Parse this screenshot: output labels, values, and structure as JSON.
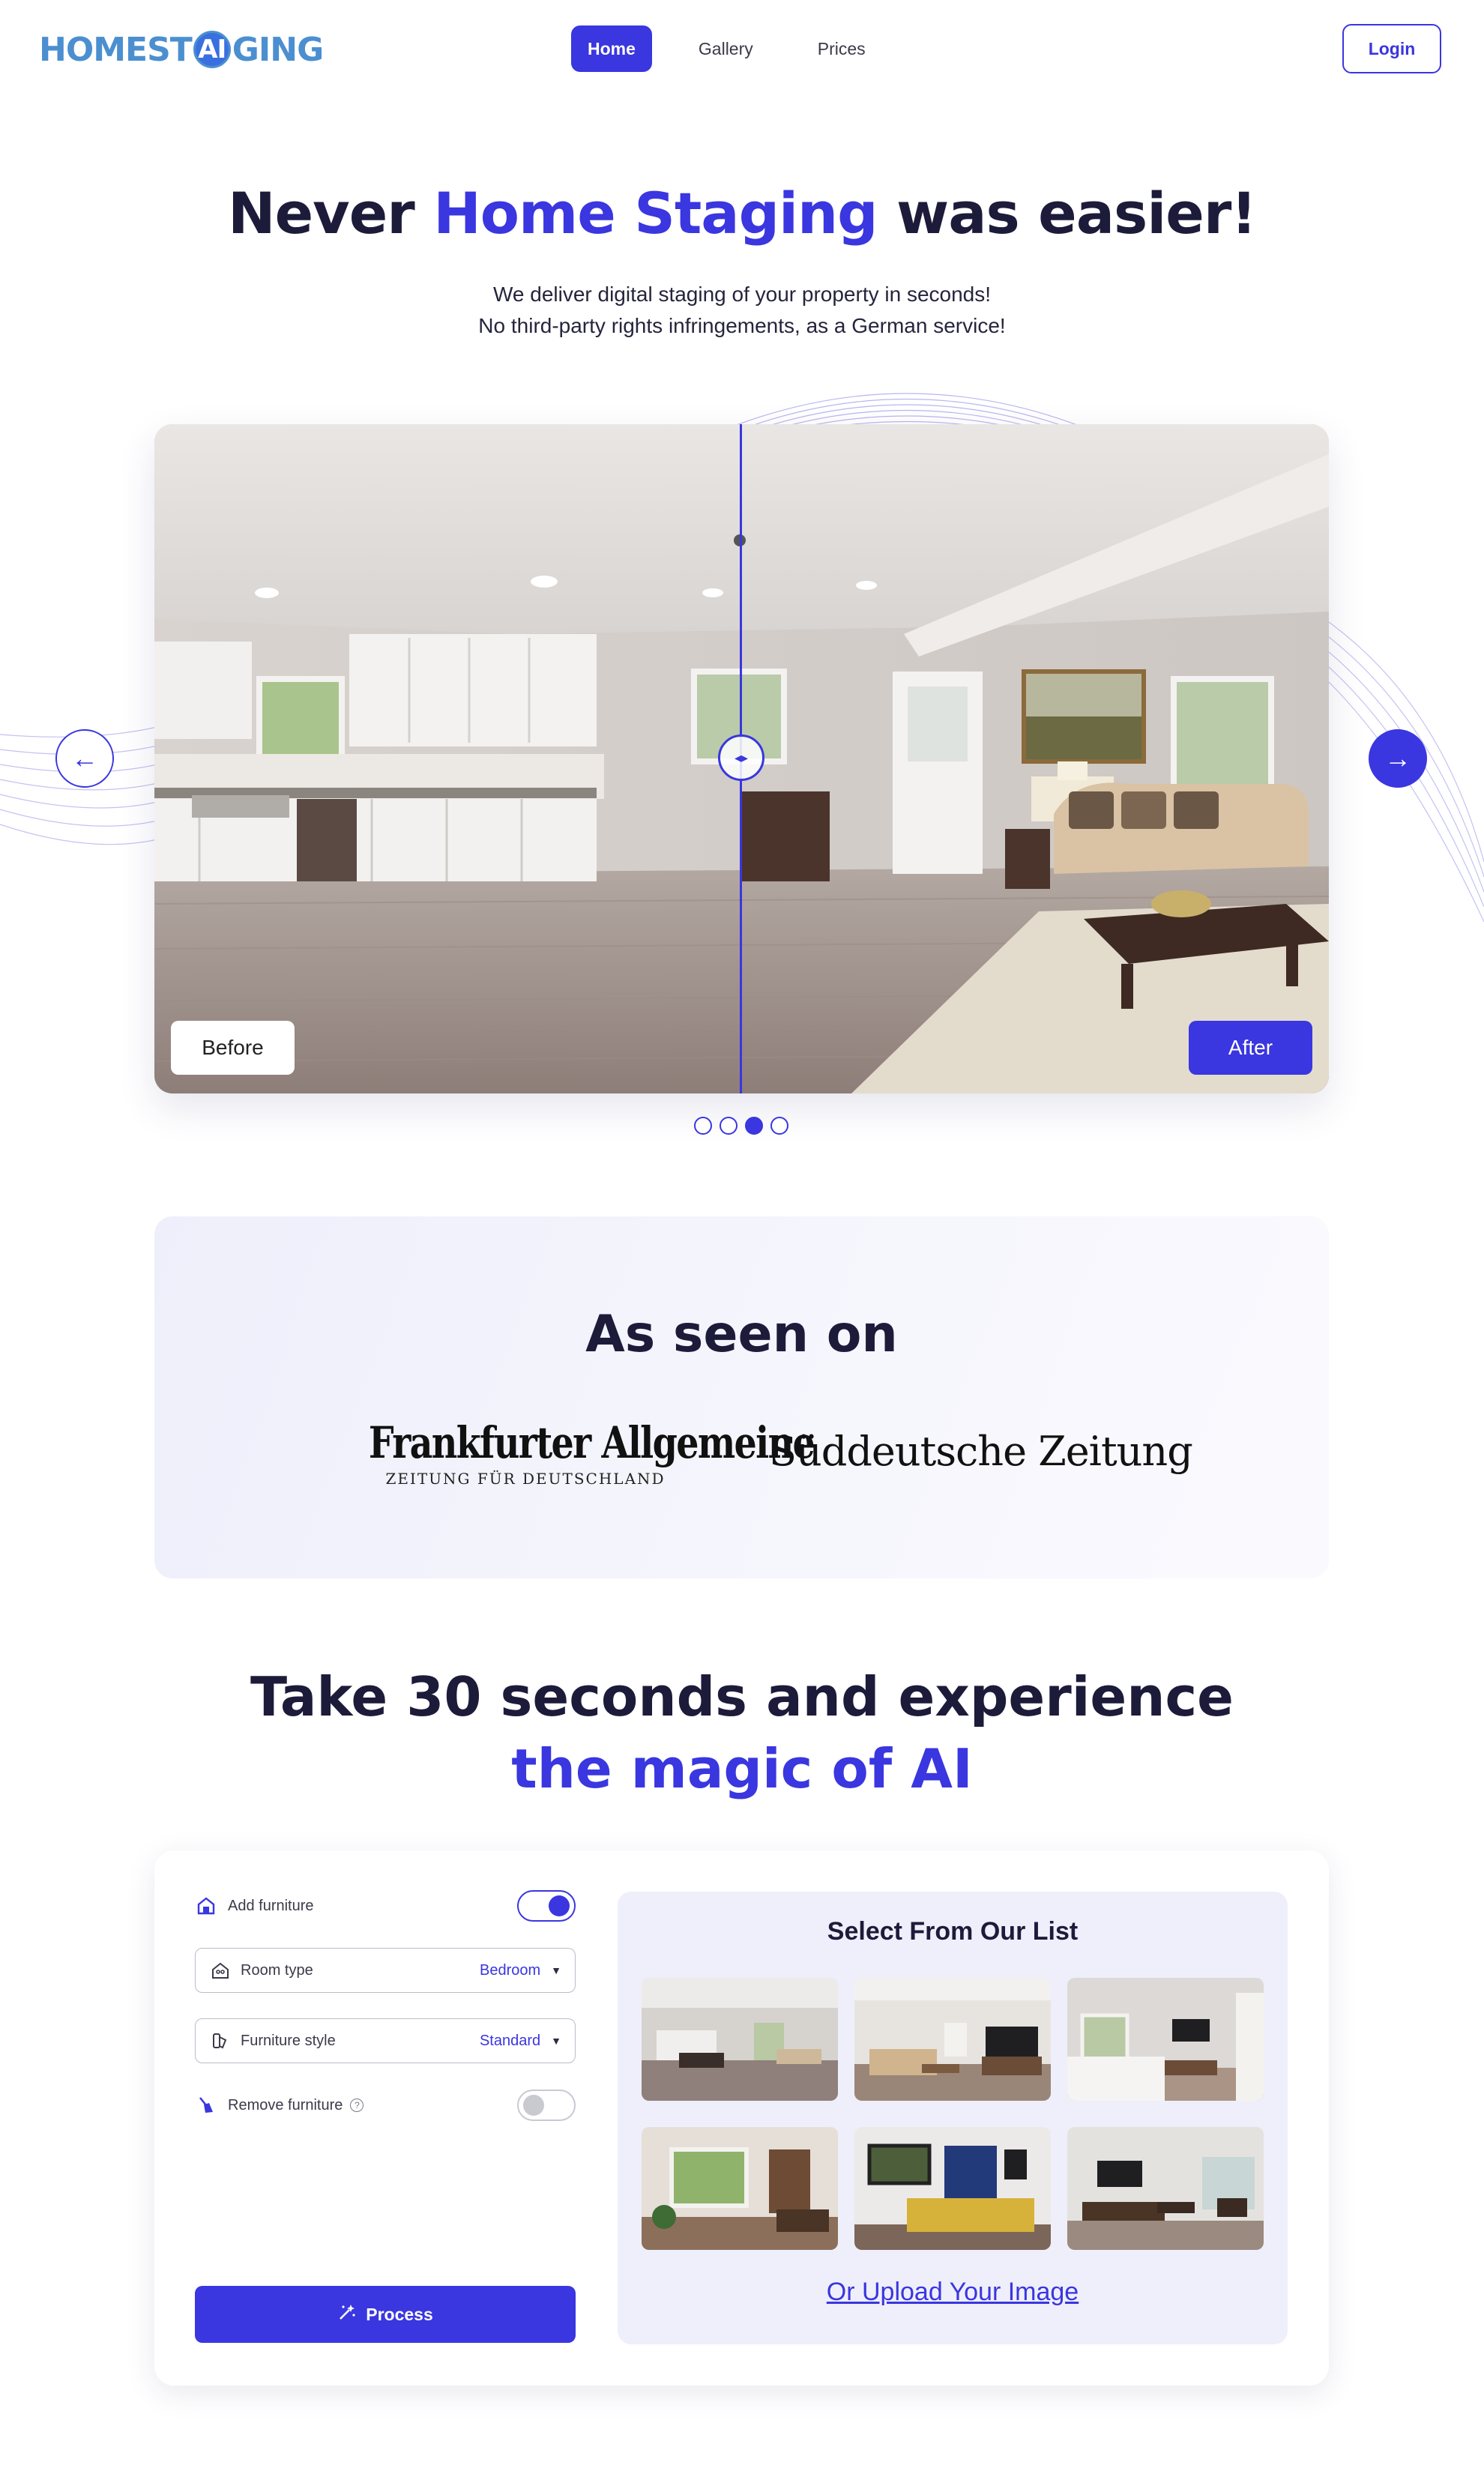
{
  "header": {
    "logo_text": "HOMESTAIGING",
    "logo_pre": "HOMEST",
    "logo_ai": "AI",
    "logo_post": "GING",
    "nav": [
      {
        "label": "Home",
        "active": true
      },
      {
        "label": "Gallery",
        "active": false
      },
      {
        "label": "Prices",
        "active": false
      }
    ],
    "login_label": "Login"
  },
  "hero": {
    "title_pre": "Never ",
    "title_accent": "Home Staging",
    "title_post": " was easier!",
    "subtitle_line1": "We deliver digital staging of your property in seconds!",
    "subtitle_line2": "No third-party rights infringements, as a German service!"
  },
  "slider": {
    "before_label": "Before",
    "after_label": "After",
    "prev_icon": "arrow-left-icon",
    "next_icon": "arrow-right-icon",
    "slides_total": 4,
    "active_slide": 3
  },
  "seen_on": {
    "title": "As seen on",
    "faz_name": "Frankfurter Allgemeine",
    "faz_sub": "ZEITUNG FÜR DEUTSCHLAND",
    "sz_name": "Süddeutsche Zeitung"
  },
  "magic": {
    "line1": "Take 30 seconds and experience",
    "line2": "the magic of AI"
  },
  "controls": {
    "add_furniture_label": "Add furniture",
    "add_furniture_on": true,
    "room_type_label": "Room type",
    "room_type_value": "Bedroom",
    "furniture_style_label": "Furniture style",
    "furniture_style_value": "Standard",
    "remove_furniture_label": "Remove furniture",
    "remove_furniture_on": false,
    "help_icon": "?",
    "process_label": "Process"
  },
  "gallery": {
    "title": "Select From Our List",
    "upload_label": "Or Upload Your Image"
  },
  "colors": {
    "accent": "#3a36e0",
    "text": "#1d1b3a",
    "panel_bg": "#efeffb"
  }
}
